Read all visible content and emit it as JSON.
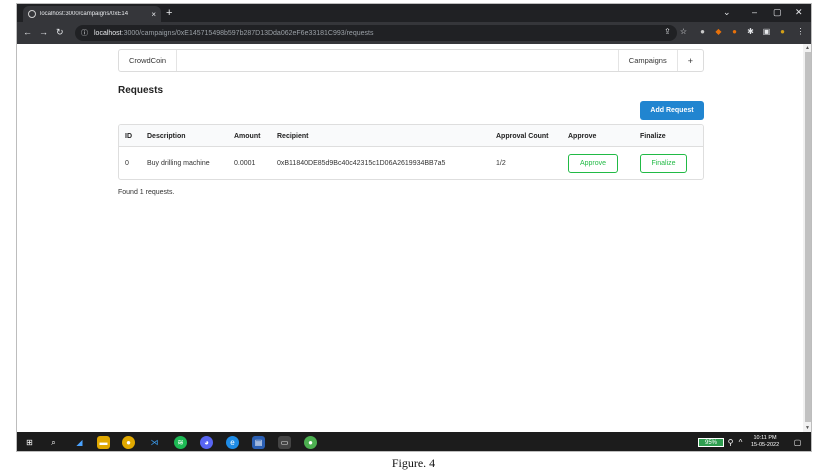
{
  "browser": {
    "tab_title": "localhost:3000/campaigns/0xE14",
    "new_tab": "+",
    "url_host": "localhost",
    "url_path": ":3000/campaigns/0xE145715498b597b287D13Dda062eF6e33181C993/requests"
  },
  "menu": {
    "brand": "CrowdCoin",
    "campaigns": "Campaigns",
    "plus": "+"
  },
  "page": {
    "heading": "Requests",
    "add_request": "Add Request",
    "found_text": "Found 1 requests."
  },
  "table": {
    "headers": [
      "ID",
      "Description",
      "Amount",
      "Recipient",
      "Approval Count",
      "Approve",
      "Finalize"
    ],
    "rows": [
      {
        "id": "0",
        "description": "Buy drilling machine",
        "amount": "0.0001",
        "recipient": "0xB11840DE85d9Bc40c42315c1D06A2619934BB7a5",
        "approval_count": "1/2",
        "approve_label": "Approve",
        "finalize_label": "Finalize"
      }
    ]
  },
  "taskbar": {
    "battery": "95%",
    "time": "10:11 PM",
    "date": "15-05-2022"
  },
  "caption": "Figure. 4",
  "colors": {
    "primary": "#2185d0",
    "positive": "#21ba45",
    "chrome_dark": "#202124"
  }
}
